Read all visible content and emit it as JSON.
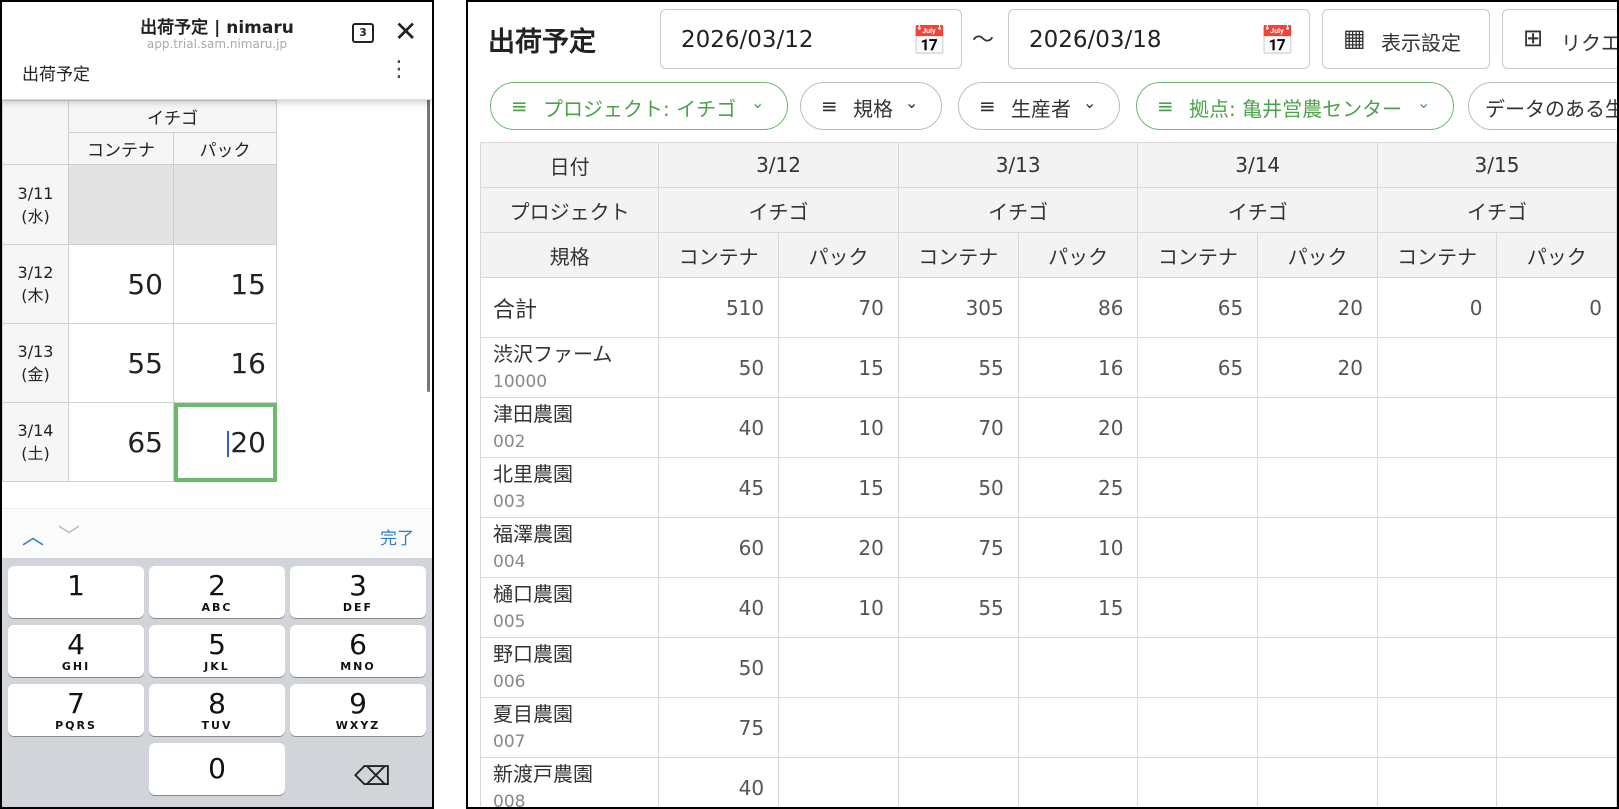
{
  "phone": {
    "title": "出荷予定 | nimaru",
    "url": "app.trial.sam.nimaru.jp",
    "tab_count": "3",
    "page_label": "出荷予定",
    "grid": {
      "project": "イチゴ",
      "col1": "コンテナ",
      "col2": "パック",
      "rows": [
        {
          "date": "3/11",
          "dow": "(水)",
          "c": "",
          "p": ""
        },
        {
          "date": "3/12",
          "dow": "(木)",
          "c": "50",
          "p": "15"
        },
        {
          "date": "3/13",
          "dow": "(金)",
          "c": "55",
          "p": "16"
        },
        {
          "date": "3/14",
          "dow": "(土)",
          "c": "65",
          "p": "20"
        }
      ]
    },
    "done_label": "完了",
    "keypad": [
      {
        "n": "1",
        "l": ""
      },
      {
        "n": "2",
        "l": "ABC"
      },
      {
        "n": "3",
        "l": "DEF"
      },
      {
        "n": "4",
        "l": "GHI"
      },
      {
        "n": "5",
        "l": "JKL"
      },
      {
        "n": "6",
        "l": "MNO"
      },
      {
        "n": "7",
        "l": "PQRS"
      },
      {
        "n": "8",
        "l": "TUV"
      },
      {
        "n": "9",
        "l": "WXYZ"
      },
      {
        "n": "0",
        "l": ""
      }
    ]
  },
  "desktop": {
    "title": "出荷予定",
    "date_from": "2026/03/12",
    "date_to": "2026/03/18",
    "tilde": "～",
    "display_settings": "表示設定",
    "request_label": "リクエ",
    "filters": [
      {
        "label": "プロジェクト: イチゴ",
        "active": true
      },
      {
        "label": "規格",
        "active": false
      },
      {
        "label": "生産者",
        "active": false
      },
      {
        "label": "拠点: 亀井営農センター",
        "active": true
      },
      {
        "label": "データのある生",
        "active": false
      }
    ],
    "table": {
      "date_label": "日付",
      "project_label": "プロジェクト",
      "spec_label": "規格",
      "dates": [
        "3/12",
        "3/13",
        "3/14",
        "3/15"
      ],
      "project": "イチゴ",
      "spec1": "コンテナ",
      "spec2": "パック",
      "total_label": "合計",
      "totals": [
        "510",
        "70",
        "305",
        "86",
        "65",
        "20",
        "0",
        "0"
      ],
      "farms": [
        {
          "name": "渋沢ファーム",
          "code": "10000",
          "vals": [
            "50",
            "15",
            "55",
            "16",
            "65",
            "20",
            "",
            ""
          ]
        },
        {
          "name": "津田農園",
          "code": "002",
          "vals": [
            "40",
            "10",
            "70",
            "20",
            "",
            "",
            "",
            ""
          ]
        },
        {
          "name": "北里農園",
          "code": "003",
          "vals": [
            "45",
            "15",
            "50",
            "25",
            "",
            "",
            "",
            ""
          ]
        },
        {
          "name": "福澤農園",
          "code": "004",
          "vals": [
            "60",
            "20",
            "75",
            "10",
            "",
            "",
            "",
            ""
          ]
        },
        {
          "name": "樋口農園",
          "code": "005",
          "vals": [
            "40",
            "10",
            "55",
            "15",
            "",
            "",
            "",
            ""
          ]
        },
        {
          "name": "野口農園",
          "code": "006",
          "vals": [
            "50",
            "",
            "",
            "",
            "",
            "",
            "",
            ""
          ]
        },
        {
          "name": "夏目農園",
          "code": "007",
          "vals": [
            "75",
            "",
            "",
            "",
            "",
            "",
            "",
            ""
          ]
        },
        {
          "name": "新渡戸農園",
          "code": "008",
          "vals": [
            "40",
            "",
            "",
            "",
            "",
            "",
            "",
            ""
          ]
        }
      ]
    }
  },
  "colors": {
    "accent_green": "#49a449",
    "ios_blue": "#2a7bd1",
    "keyboard_bg": "#d1d4d9"
  },
  "icons": {
    "calendar": "calendar-icon",
    "filter": "filter-icon",
    "grid_add": "grid-add-icon",
    "close": "close-icon"
  }
}
